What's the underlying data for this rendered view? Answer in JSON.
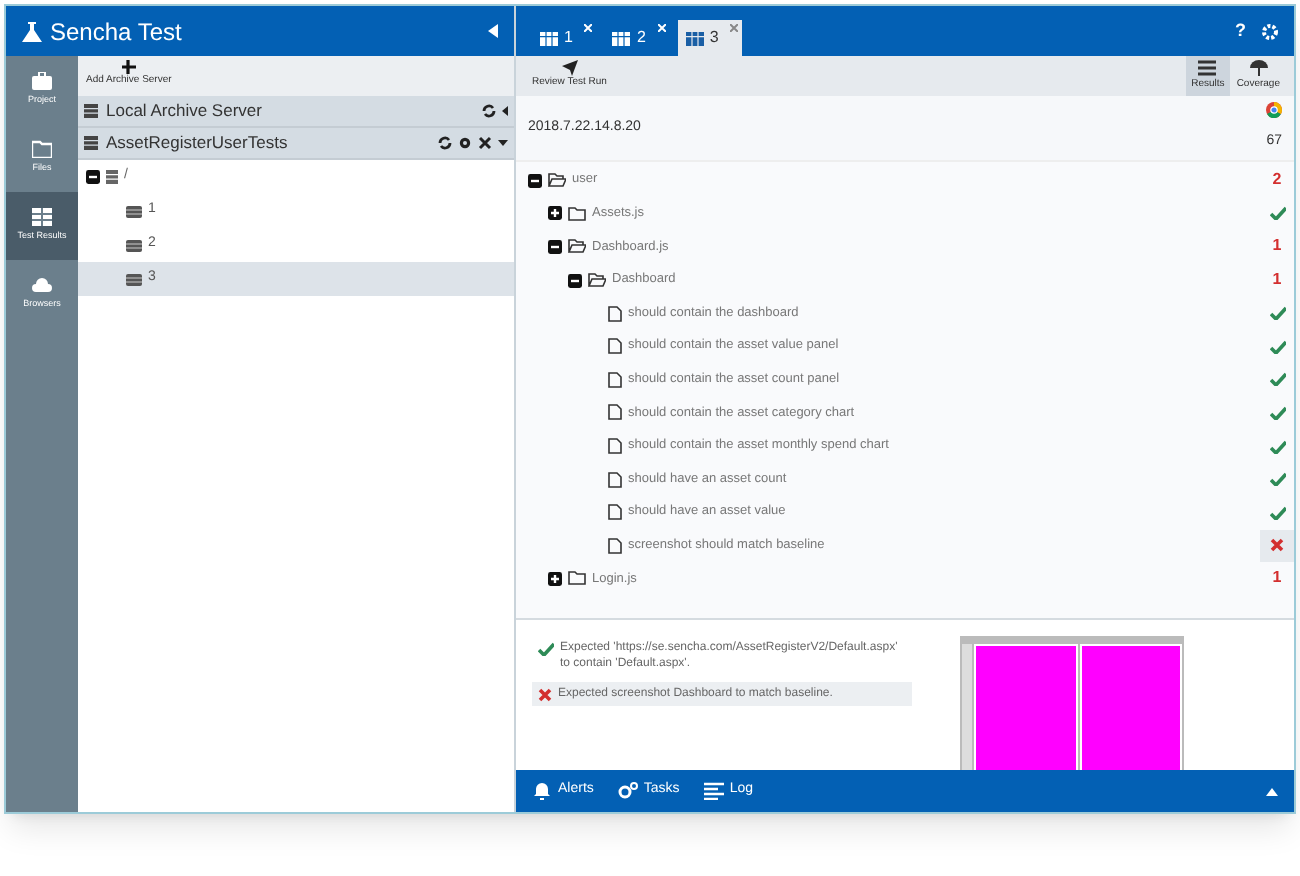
{
  "app": {
    "title": "Sencha Test"
  },
  "nav": [
    {
      "label": "Project",
      "selected": false
    },
    {
      "label": "Files",
      "selected": false
    },
    {
      "label": "Test Results",
      "selected": true
    },
    {
      "label": "Browsers",
      "selected": false
    }
  ],
  "archive_toolbar": {
    "button": "Add Archive Server"
  },
  "servers": [
    {
      "name": "Local Archive Server",
      "expanded": false
    },
    {
      "name": "AssetRegisterUserTests",
      "expanded": true
    }
  ],
  "runs": {
    "label": "/",
    "expanded": true,
    "children": [
      {
        "label": "1",
        "selected": false
      },
      {
        "label": "2",
        "selected": false
      },
      {
        "label": "3",
        "selected": true
      }
    ]
  },
  "tabs": [
    {
      "label": "1",
      "selected": false
    },
    {
      "label": "2",
      "selected": false
    },
    {
      "label": "3",
      "selected": true
    }
  ],
  "help": "?",
  "toolbar": {
    "left": "Review Test Run",
    "right": [
      {
        "label": "Results",
        "selected": true
      },
      {
        "label": "Coverage",
        "selected": false
      }
    ]
  },
  "run": {
    "timestamp": "2018.7.22.14.8.20",
    "count": "67"
  },
  "tree": [
    {
      "label": "user",
      "kind": "folder",
      "expanded": true,
      "passed": false,
      "count": "2",
      "children": [
        {
          "label": "Assets.js",
          "kind": "folder",
          "expanded": false,
          "passed": true
        },
        {
          "label": "Dashboard.js",
          "kind": "folder",
          "expanded": true,
          "passed": false,
          "count": "1",
          "children": [
            {
              "label": "Dashboard",
              "kind": "folder",
              "expanded": true,
              "passed": false,
              "count": "1",
              "children": [
                {
                  "label": "should contain the dashboard",
                  "kind": "file",
                  "passed": true
                },
                {
                  "label": "should contain the asset value panel",
                  "kind": "file",
                  "passed": true
                },
                {
                  "label": "should contain the asset count panel",
                  "kind": "file",
                  "passed": true
                },
                {
                  "label": "should contain the asset category chart",
                  "kind": "file",
                  "passed": true
                },
                {
                  "label": "should contain the asset monthly spend chart",
                  "kind": "file",
                  "passed": true
                },
                {
                  "label": "should have an asset count",
                  "kind": "file",
                  "passed": true
                },
                {
                  "label": "should have an asset value",
                  "kind": "file",
                  "passed": true
                },
                {
                  "label": "screenshot should match baseline",
                  "kind": "file",
                  "passed": false,
                  "selected": true
                }
              ]
            }
          ]
        },
        {
          "label": "Login.js",
          "kind": "folder",
          "expanded": false,
          "passed": false,
          "count": "1"
        }
      ]
    }
  ],
  "expectations": [
    {
      "text": "Expected 'https://se.sencha.com/AssetRegisterV2/Default.aspx' to contain 'Default.aspx'.",
      "passed": true,
      "selected": false
    },
    {
      "text": "Expected screenshot Dashboard to match baseline.",
      "passed": false,
      "selected": true
    }
  ],
  "bottom_bar": [
    {
      "label": "Alerts"
    },
    {
      "label": "Tasks"
    },
    {
      "label": "Log"
    }
  ]
}
